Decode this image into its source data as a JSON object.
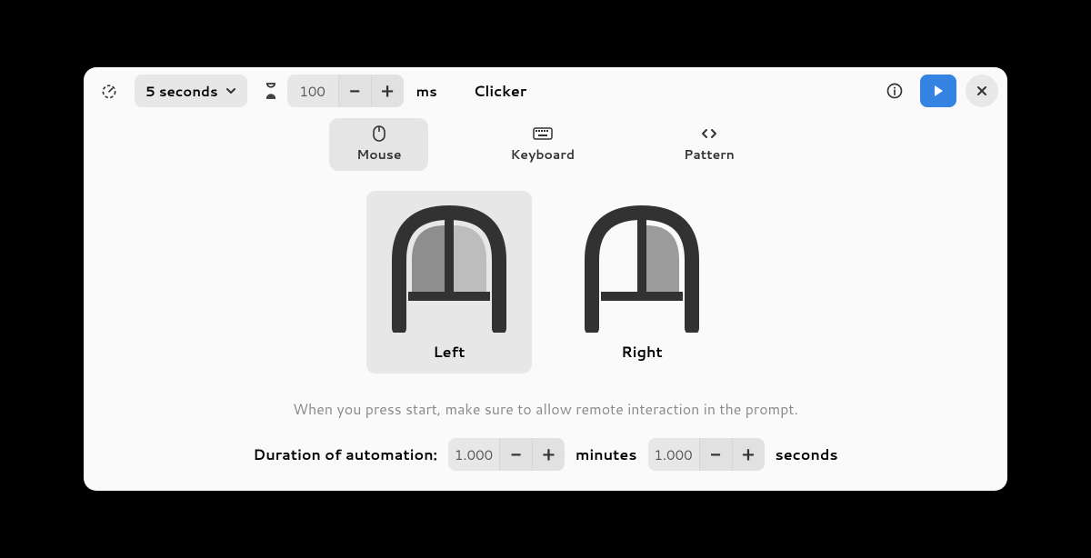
{
  "header": {
    "countdown_value": "5 seconds",
    "interval_value": "100",
    "interval_unit": "ms",
    "app_title": "Clicker"
  },
  "tabs": {
    "mouse": "Mouse",
    "keyboard": "Keyboard",
    "pattern": "Pattern"
  },
  "mouse": {
    "left": "Left",
    "right": "Right"
  },
  "hint": "When you press start, make sure to allow remote interaction in the prompt.",
  "duration": {
    "label": "Duration of automation:",
    "minutes_value": "1.000",
    "minutes_unit": "minutes",
    "seconds_value": "1.000",
    "seconds_unit": "seconds"
  }
}
